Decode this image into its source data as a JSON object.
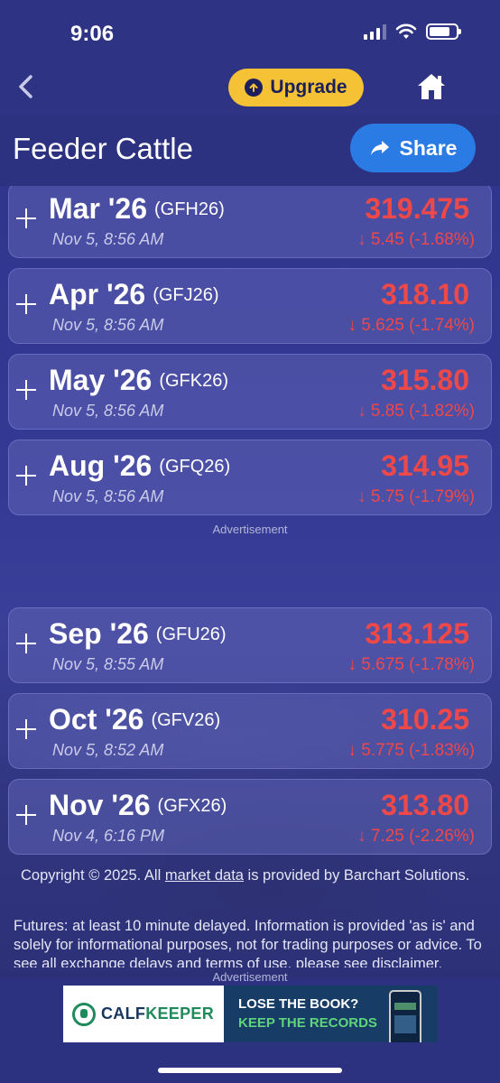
{
  "status_bar": {
    "time": "9:06"
  },
  "nav": {
    "upgrade_label": "Upgrade"
  },
  "header": {
    "title": "Feeder Cattle",
    "share_label": "Share"
  },
  "contracts": [
    {
      "name": "Mar '26",
      "symbol": "(GFH26)",
      "time": "Nov 5, 8:56 AM",
      "price": "319.475",
      "change": "↓ 5.45 (-1.68%)"
    },
    {
      "name": "Apr '26",
      "symbol": "(GFJ26)",
      "time": "Nov 5, 8:56 AM",
      "price": "318.10",
      "change": "↓ 5.625 (-1.74%)"
    },
    {
      "name": "May '26",
      "symbol": "(GFK26)",
      "time": "Nov 5, 8:56 AM",
      "price": "315.80",
      "change": "↓ 5.85 (-1.82%)"
    },
    {
      "name": "Aug '26",
      "symbol": "(GFQ26)",
      "time": "Nov 5, 8:56 AM",
      "price": "314.95",
      "change": "↓ 5.75 (-1.79%)"
    },
    {
      "name": "Sep '26",
      "symbol": "(GFU26)",
      "time": "Nov 5, 8:55 AM",
      "price": "313.125",
      "change": "↓ 5.675 (-1.78%)"
    },
    {
      "name": "Oct '26",
      "symbol": "(GFV26)",
      "time": "Nov 5, 8:52 AM",
      "price": "310.25",
      "change": "↓ 5.775 (-1.83%)"
    },
    {
      "name": "Nov '26",
      "symbol": "(GFX26)",
      "time": "Nov 4, 6:16 PM",
      "price": "313.80",
      "change": "↓ 7.25 (-2.26%)"
    }
  ],
  "ad_label": "Advertisement",
  "footer": {
    "copyright_prefix": "Copyright © 2025. All ",
    "copyright_link": "market data",
    "copyright_suffix": " is provided by Barchart Solutions.",
    "disclaimer": "Futures: at least 10 minute delayed. Information is provided 'as is' and solely for informational purposes, not for trading purposes or advice. To see all exchange delays and terms of use, please see disclaimer."
  },
  "banner_ad": {
    "brand_part1": "CALF",
    "brand_part2": "KEEPER",
    "line1": "LOSE THE BOOK?",
    "line2": "KEEP THE RECORDS"
  },
  "colors": {
    "negative": "#ef4848",
    "accent": "#2b7be5",
    "upgrade": "#f6c235",
    "background": "#2c3180"
  }
}
